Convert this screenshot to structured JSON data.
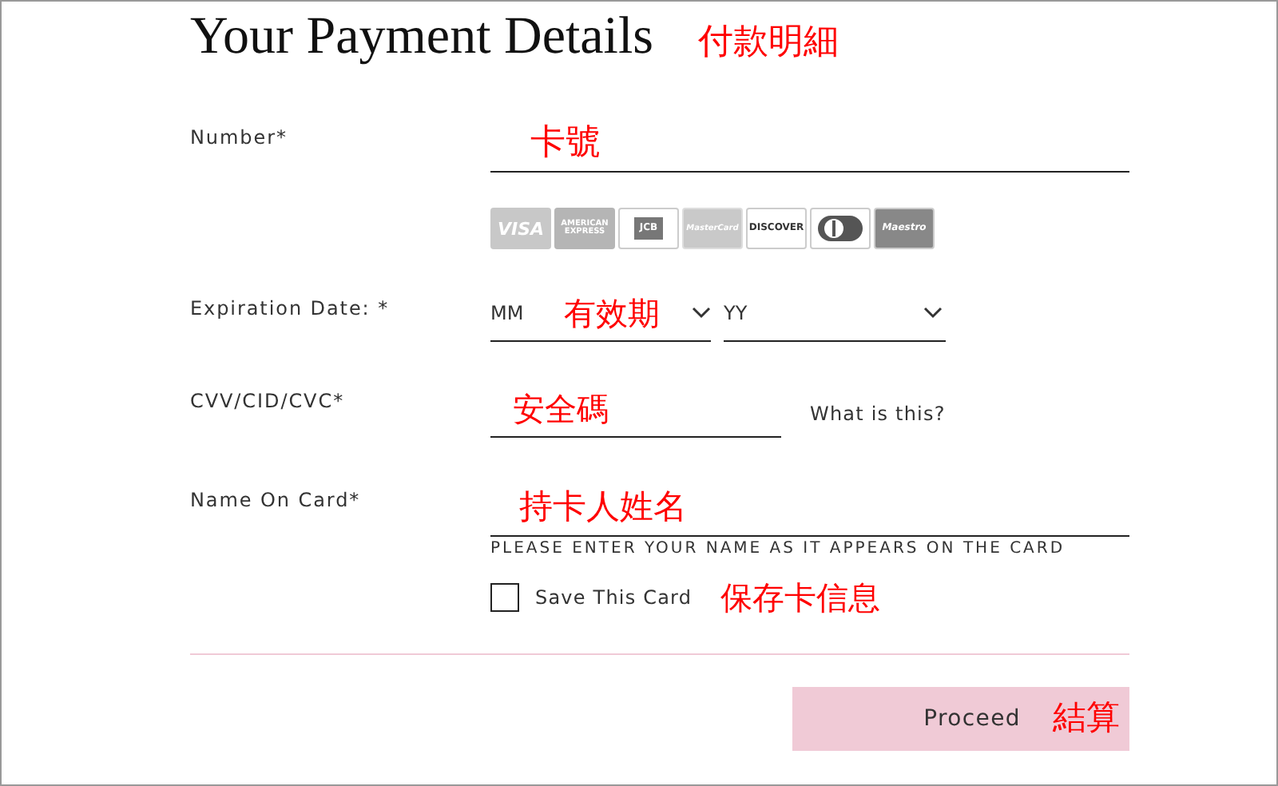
{
  "title": "Your Payment Details",
  "title_annotation": "付款明細",
  "number": {
    "label": "Number*",
    "annotation": "卡號"
  },
  "cards": [
    {
      "kind": "visa",
      "label": "VISA"
    },
    {
      "kind": "amex",
      "label": "AMERICAN EXPRESS"
    },
    {
      "kind": "jcb",
      "label": "JCB"
    },
    {
      "kind": "mastercard",
      "label": "MasterCard"
    },
    {
      "kind": "discover",
      "label": "DISCOVER"
    },
    {
      "kind": "diners"
    },
    {
      "kind": "maestro",
      "label": "Maestro"
    }
  ],
  "expiration": {
    "label": "Expiration Date: *",
    "month": "MM",
    "annotation": "有效期",
    "year": "YY"
  },
  "cvv": {
    "label": "CVV/CID/CVC*",
    "annotation": "安全碼",
    "help_link": "What is this?"
  },
  "name": {
    "label": "Name On Card*",
    "annotation": "持卡人姓名",
    "hint": "PLEASE ENTER YOUR NAME AS IT APPEARS ON THE CARD"
  },
  "save_card": {
    "label": "Save This Card",
    "checked": false,
    "annotation": "保存卡信息"
  },
  "proceed": {
    "label": "Proceed",
    "annotation": "結算"
  }
}
